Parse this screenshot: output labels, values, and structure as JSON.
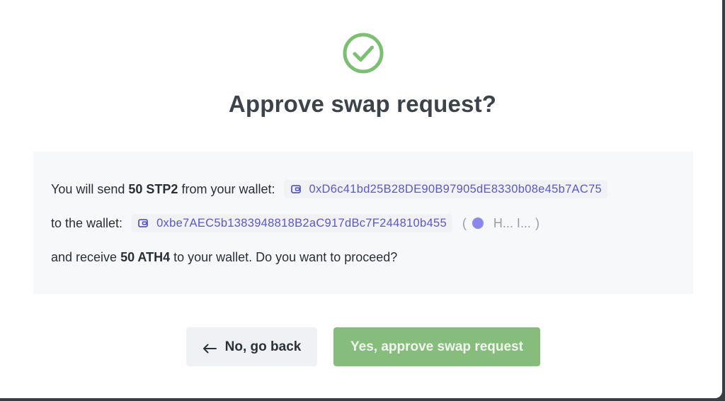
{
  "dialog": {
    "title": "Approve swap request?",
    "icon": "check-circle-icon",
    "accent_color": "#7cbf72"
  },
  "details": {
    "line1": {
      "prefix": "You will send ",
      "amount": "50 STP2",
      "suffix": " from your wallet:",
      "address": "0xD6c41bd25B28DE90B97905dE8330b08e45b7AC75"
    },
    "line2": {
      "prefix": "to the wallet:",
      "address": "0xbe7AEC5b1383948818B2aC917dBc7F244810b455",
      "open_paren": "(",
      "identity": "H... I...",
      "close_paren": ")"
    },
    "line3": {
      "prefix": "and receive ",
      "amount": "50 ATH4",
      "suffix": " to your wallet. Do you want to proceed?"
    }
  },
  "actions": {
    "back_label": "No, go back",
    "approve_label": "Yes, approve swap request"
  }
}
